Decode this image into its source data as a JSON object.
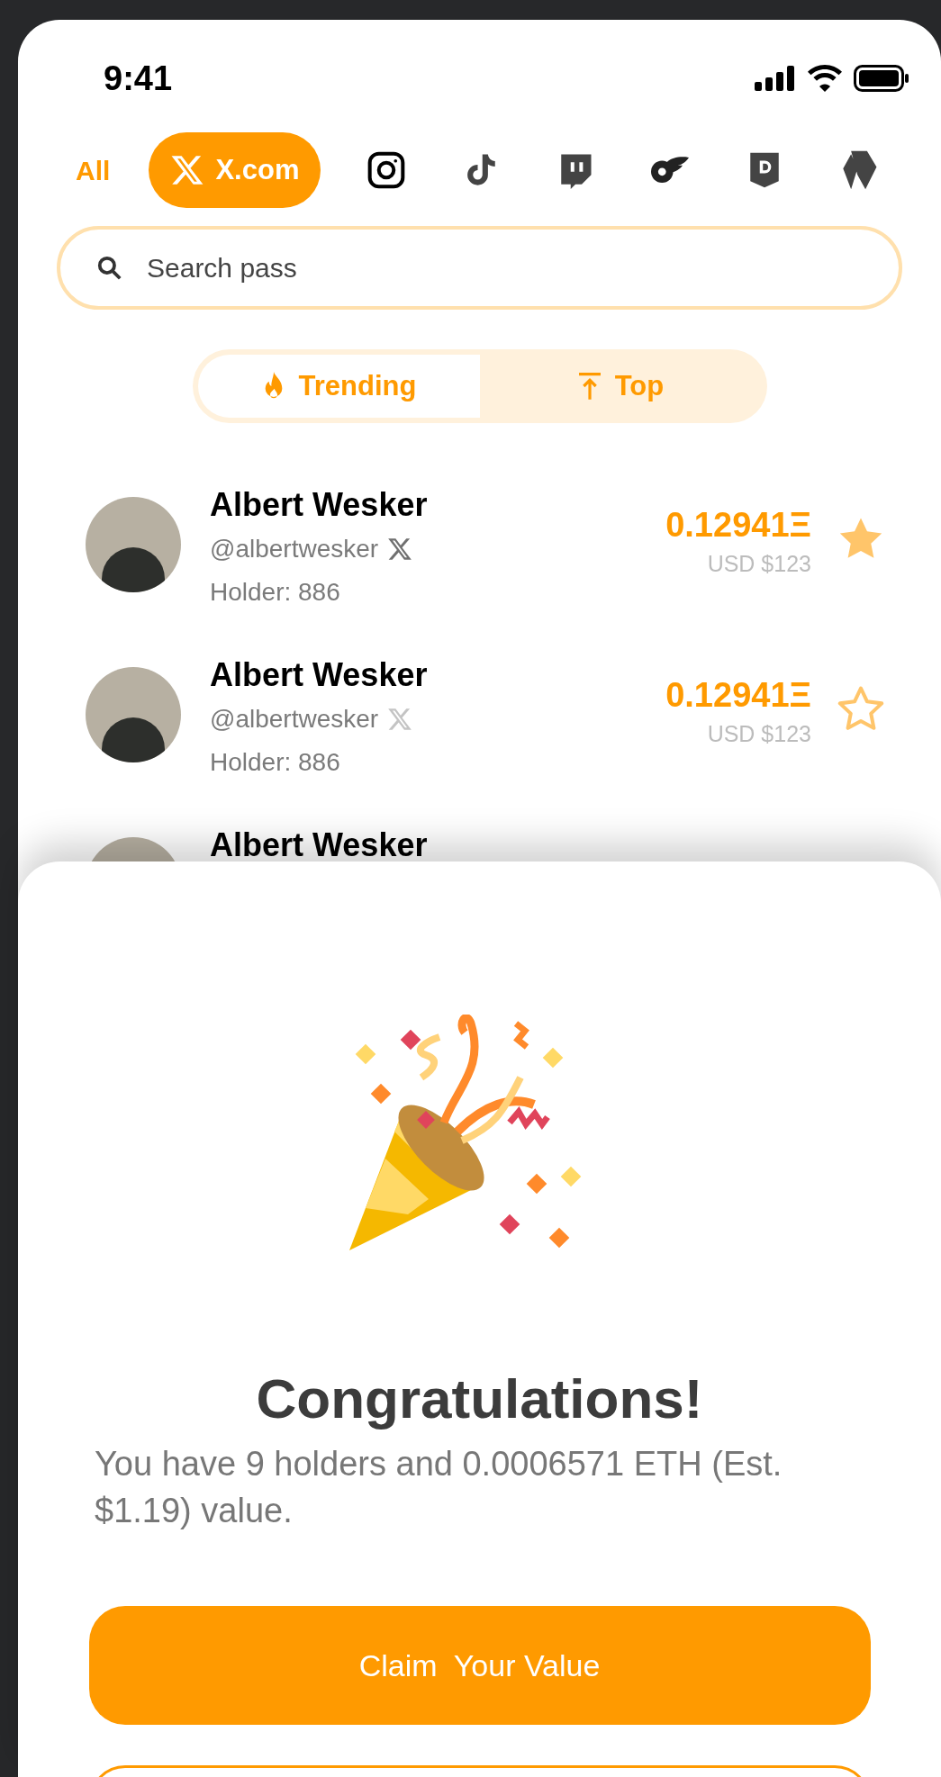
{
  "status_bar": {
    "time": "9:41"
  },
  "filters": [
    {
      "kind": "text",
      "label": "All",
      "selected": false
    },
    {
      "kind": "x",
      "label": "X.com",
      "selected": true
    },
    {
      "kind": "instagram",
      "selected": false
    },
    {
      "kind": "tiktok",
      "selected": false
    },
    {
      "kind": "twitch",
      "selected": false
    },
    {
      "kind": "onlyfans",
      "selected": false
    },
    {
      "kind": "d",
      "selected": false
    },
    {
      "kind": "ens",
      "selected": false
    }
  ],
  "search": {
    "placeholder": "Search pass"
  },
  "sort_tabs": [
    {
      "kind": "flame",
      "label": "Trending",
      "selected": true
    },
    {
      "kind": "top",
      "label": "Top",
      "selected": false
    }
  ],
  "passes": [
    {
      "name": "Albert Wesker",
      "handle": "@albertwesker",
      "x_active": true,
      "holders": "Holder: 886",
      "price": "0.12941Ξ",
      "usd": "USD $123",
      "favorite": true
    },
    {
      "name": "Albert Wesker",
      "handle": "@albertwesker",
      "x_active": false,
      "holders": "Holder: 886",
      "price": "0.12941Ξ",
      "usd": "USD $123",
      "favorite": false
    },
    {
      "name": "Albert Wesker"
    }
  ],
  "sheet": {
    "title": "Congratulations!",
    "message": "You have 9 holders and 0.0006571 ETH (Est. $1.19) value.",
    "primary_button": "Claim  Your Value"
  }
}
